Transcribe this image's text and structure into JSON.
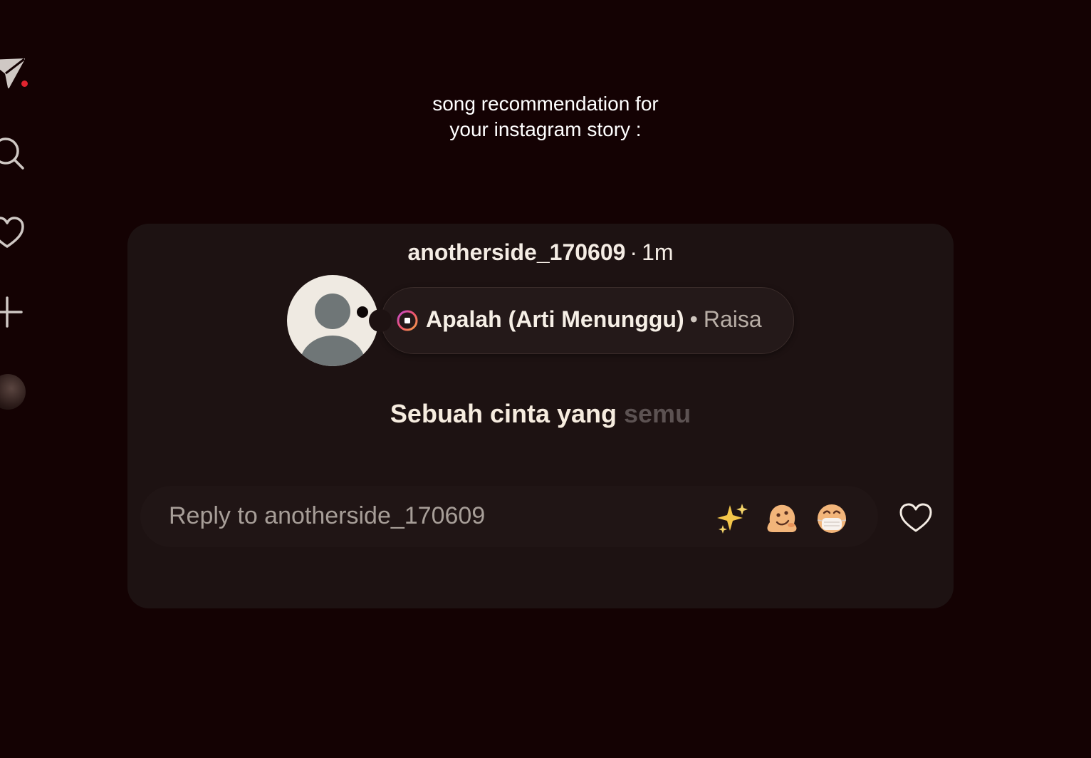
{
  "sidebar": {
    "icons": [
      "paper-plane-icon",
      "search-icon",
      "heart-icon",
      "plus-icon"
    ],
    "has_notification": true
  },
  "caption": {
    "line1": "song recommendation for",
    "line2": "your instagram story :"
  },
  "story": {
    "username": "anotherside_170609",
    "separator": "·",
    "time": "1m",
    "music": {
      "title": "Apalah (Arti Menunggu)",
      "separator": "•",
      "artist": "Raisa"
    },
    "lyric": {
      "sung": "Sebuah cinta yang",
      "unsung": "semu"
    },
    "reply": {
      "placeholder": "Reply to anotherside_170609"
    },
    "quick_reactions": [
      "sparkles-emoji",
      "melting-face-emoji",
      "face-with-medical-mask-emoji"
    ]
  },
  "colors": {
    "background": "#140203",
    "card": "#1d1212",
    "notification": "#e0242f"
  }
}
